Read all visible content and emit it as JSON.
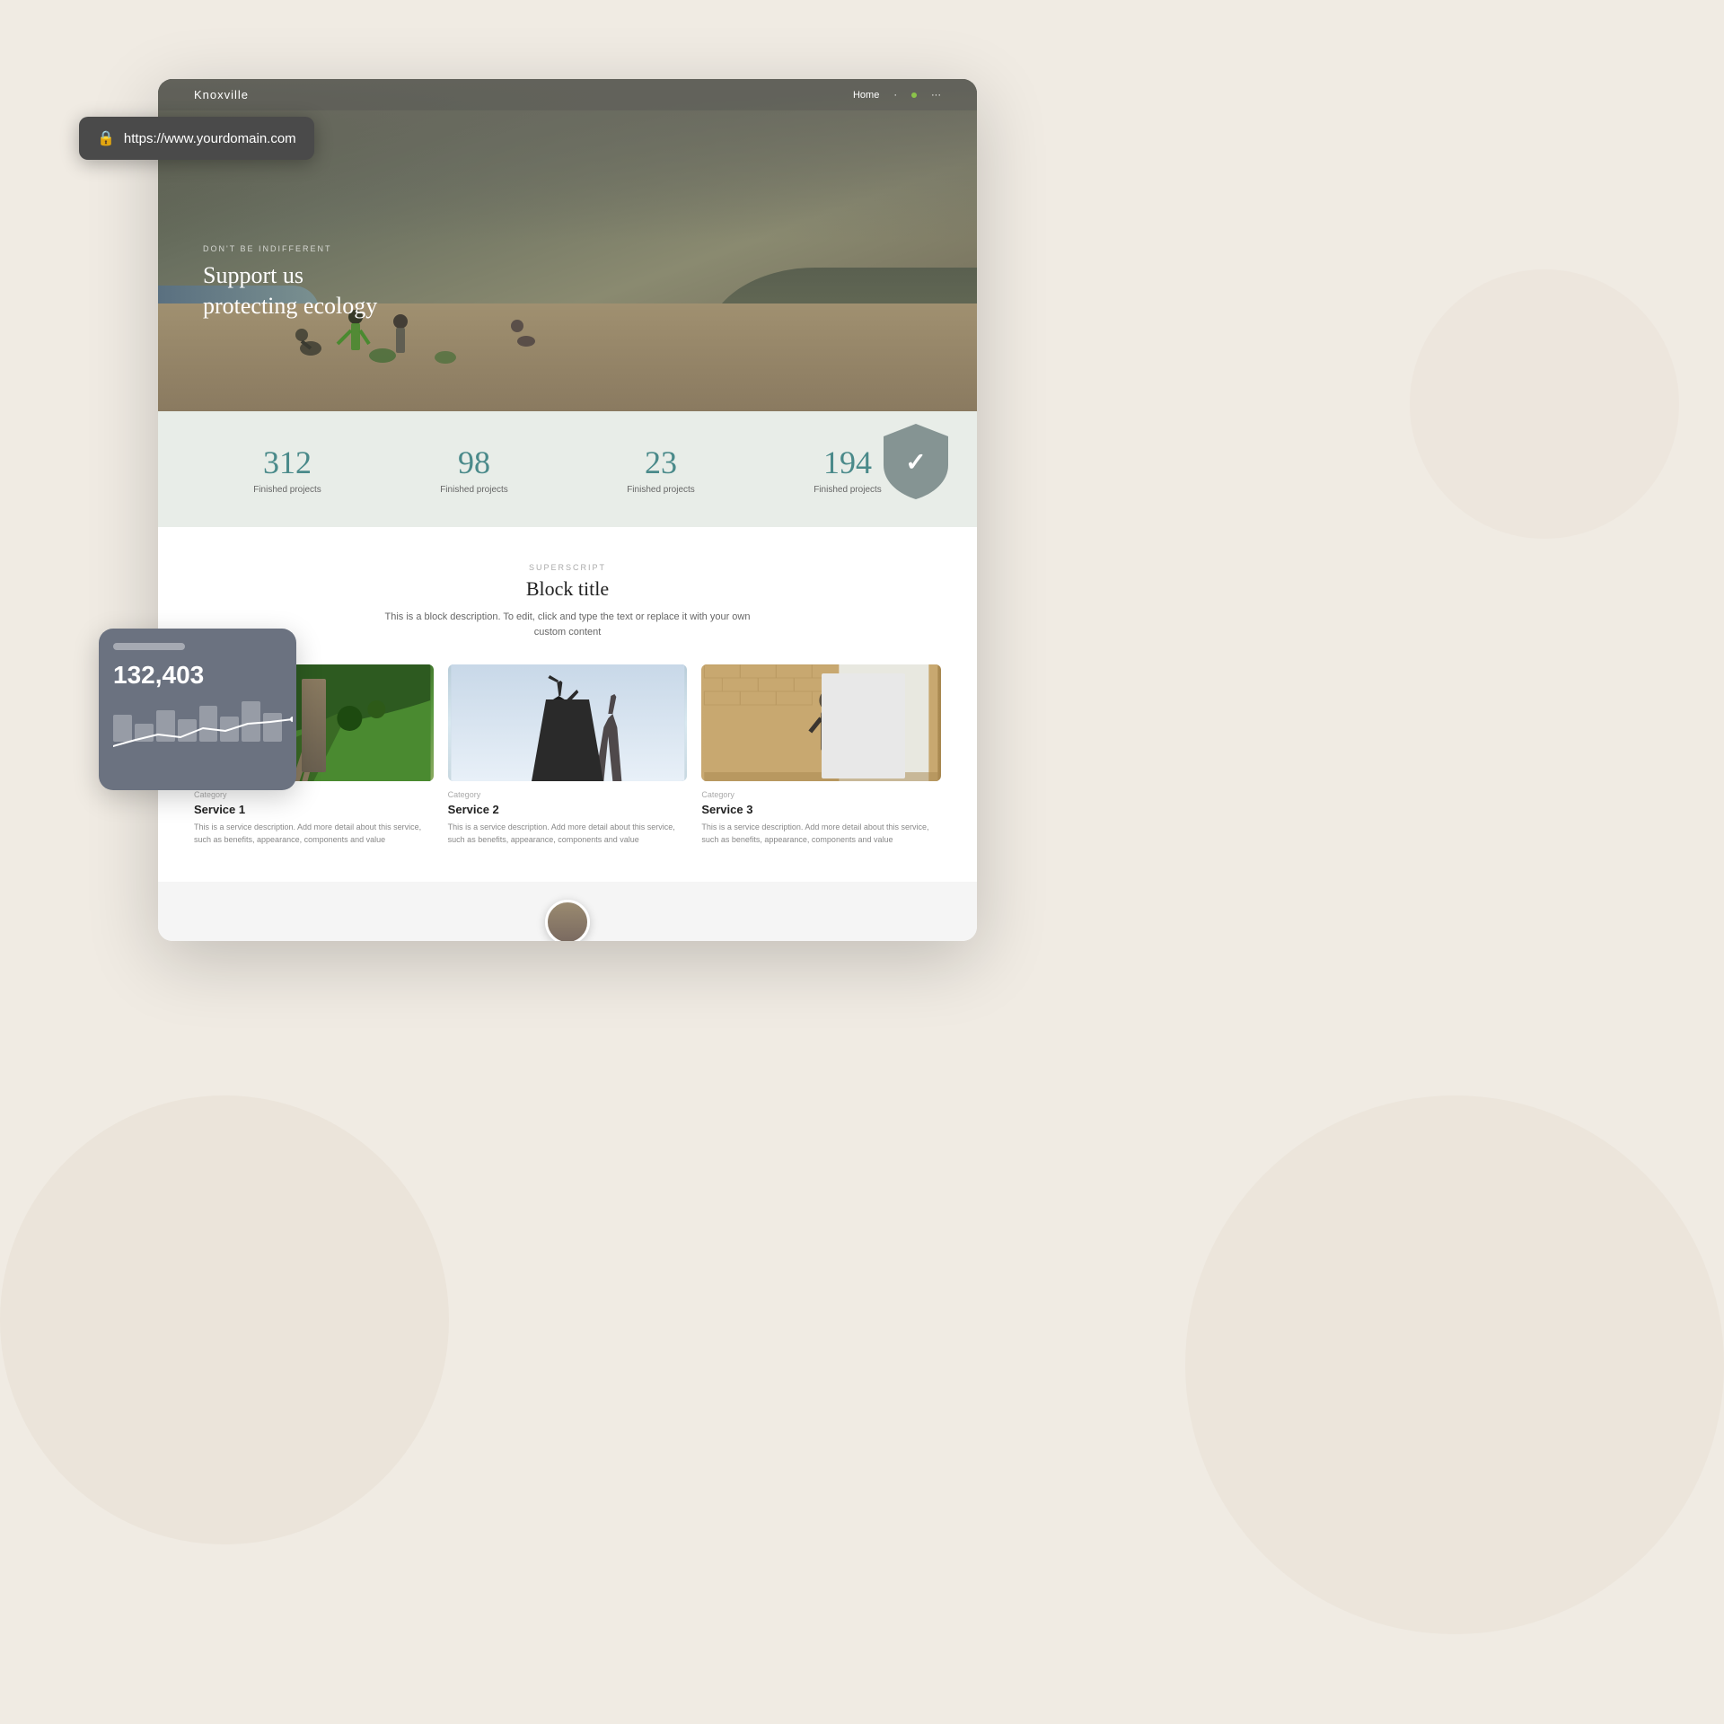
{
  "page": {
    "background": "#f0ebe3"
  },
  "url_bar": {
    "url": "https://www.yourdomain.com",
    "lock_icon": "🔒"
  },
  "website": {
    "nav": {
      "brand": "Knoxville",
      "home_link": "Home"
    },
    "hero": {
      "superscript": "DON'T BE INDIFFERENT",
      "title_line1": "Support us",
      "title_line2": "protecting ecology"
    },
    "stats": [
      {
        "number": "312",
        "label": "Finished projects"
      },
      {
        "number": "98",
        "label": "Finished projects"
      },
      {
        "number": "23",
        "label": "Finished projects"
      },
      {
        "number": "194",
        "label": "Finished projects"
      }
    ],
    "services": {
      "superscript": "SUPERSCRIPT",
      "title": "Block title",
      "description_line1": "This is a block description. To edit, click and type the text or replace it with your own",
      "description_line2": "custom content",
      "items": [
        {
          "category": "Category",
          "name": "Service 1",
          "description": "This is a service description. Add more detail about this service, such as benefits, appearance, components and value"
        },
        {
          "category": "Category",
          "name": "Service 2",
          "description": "This is a service description. Add more detail about this service, such as benefits, appearance, components and value"
        },
        {
          "category": "Category",
          "name": "Service 3",
          "description": "This is a service description. Add more detail about this service, such as benefits, appearance, components and value"
        }
      ]
    }
  },
  "analytics_card": {
    "number": "132,403"
  },
  "shield": {
    "icon": "✓"
  }
}
